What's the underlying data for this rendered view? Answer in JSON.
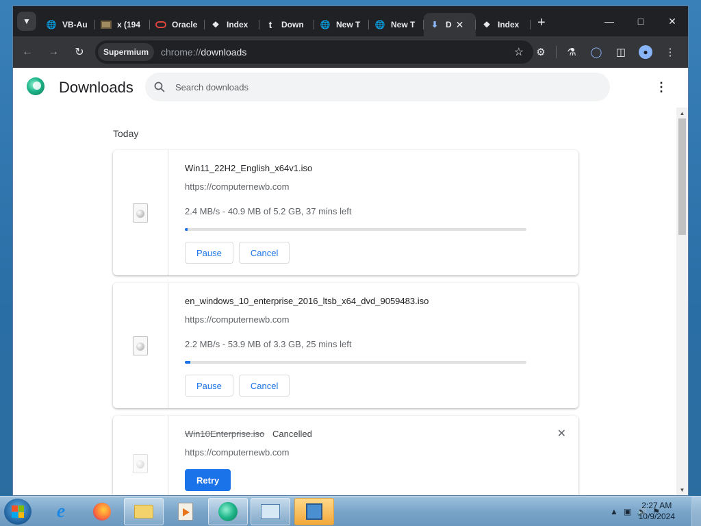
{
  "browser": {
    "tabs": [
      {
        "title": "VB-Au",
        "icon": "globe-icon"
      },
      {
        "title": "x (194",
        "icon": "video-thumb-icon"
      },
      {
        "title": "Oracle",
        "icon": "oracle-icon"
      },
      {
        "title": "Index",
        "icon": "index-icon"
      },
      {
        "title": "Down",
        "icon": "t-icon"
      },
      {
        "title": "New T",
        "icon": "globe-icon"
      },
      {
        "title": "New T",
        "icon": "globe-icon"
      },
      {
        "title": "D",
        "icon": "download-icon",
        "active": true
      },
      {
        "title": "Index",
        "icon": "index-icon"
      }
    ],
    "site_chip": "Supermium",
    "url_scheme": "chrome://",
    "url_path": "downloads"
  },
  "page": {
    "title": "Downloads",
    "search_placeholder": "Search downloads",
    "day_label": "Today",
    "downloads": [
      {
        "filename": "Win11_22H2_English_x64v1.iso",
        "source": "https://computernewb.com",
        "progress_text": "2.4 MB/s - 40.9 MB of 5.2 GB, 37 mins left",
        "progress": 0.008,
        "buttons": [
          "Pause",
          "Cancel"
        ]
      },
      {
        "filename": "en_windows_10_enterprise_2016_ltsb_x64_dvd_9059483.iso",
        "source": "https://computernewb.com",
        "progress_text": "2.2 MB/s - 53.9 MB of 3.3 GB, 25 mins left",
        "progress": 0.016,
        "buttons": [
          "Pause",
          "Cancel"
        ]
      },
      {
        "filename": "Win10Enterprise.iso",
        "status": "Cancelled",
        "source": "https://computernewb.com",
        "buttons": [
          "Retry"
        ]
      }
    ]
  },
  "taskbar": {
    "time": "2:27 AM",
    "date": "10/9/2024"
  },
  "colors": {
    "accent": "#1a73e8",
    "tabstrip": "#202124",
    "toolbar": "#35363a"
  }
}
